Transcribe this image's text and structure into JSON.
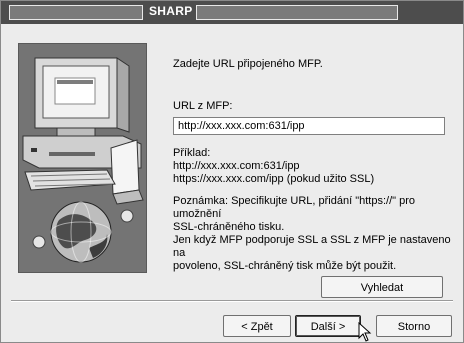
{
  "window": {
    "title": "SHARP"
  },
  "main": {
    "instruction": "Zadejte URL připojeného MFP.",
    "url_label": "URL z MFP:",
    "url_value": "http://xxx.xxx.com:631/ipp",
    "example": "Příklad:\nhttp://xxx.xxx.com:631/ipp\nhttps://xxx.xxx.com/ipp (pokud užito SSL)",
    "note": "Poznámka: Specifikujte URL, přidání \"https://\" pro umožnění\nSSL-chráněného tisku.\nJen když MFP podporuje SSL a SSL z MFP je nastaveno na\npovoleno, SSL-chráněný tisk může být použit."
  },
  "buttons": {
    "search": "Vyhledat",
    "back": "< Zpět",
    "next": "Další >",
    "cancel": "Storno"
  },
  "icons": {
    "illustration": "computer-globe-illustration",
    "cursor": "mouse-pointer-icon"
  }
}
